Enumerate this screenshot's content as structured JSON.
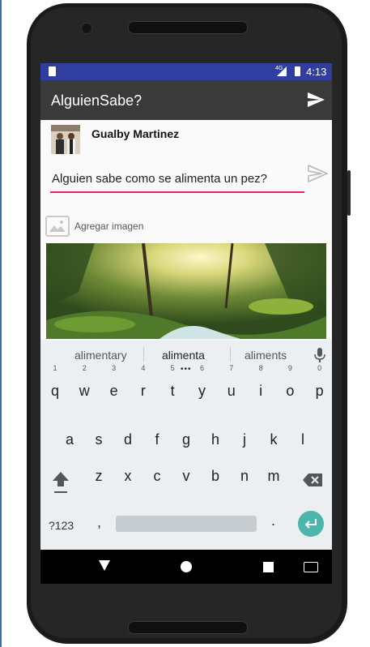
{
  "status_bar": {
    "network": "4G",
    "time": "4:13"
  },
  "app_bar": {
    "title": "AlguienSabe?"
  },
  "post": {
    "user_name": "Gualby Martinez",
    "question_value": "Alguien sabe como se alimenta un pez?",
    "add_image_label": "Agregar imagen"
  },
  "keyboard": {
    "suggestions": [
      "alimentary",
      "alimenta",
      "aliments"
    ],
    "row1": [
      {
        "k": "q",
        "n": "1"
      },
      {
        "k": "w",
        "n": "2"
      },
      {
        "k": "e",
        "n": "3"
      },
      {
        "k": "r",
        "n": "4"
      },
      {
        "k": "t",
        "n": "5"
      },
      {
        "k": "y",
        "n": "6"
      },
      {
        "k": "u",
        "n": "7"
      },
      {
        "k": "i",
        "n": "8"
      },
      {
        "k": "o",
        "n": "9"
      },
      {
        "k": "p",
        "n": "0"
      }
    ],
    "row2": [
      "a",
      "s",
      "d",
      "f",
      "g",
      "h",
      "j",
      "k",
      "l"
    ],
    "row3": [
      "z",
      "x",
      "c",
      "v",
      "b",
      "n",
      "m"
    ],
    "symbols_label": "?123",
    "comma": ",",
    "period": "."
  },
  "colors": {
    "status_bar": "#303f9f",
    "app_bar": "#3a3a3a",
    "input_underline": "#e91e63",
    "enter_key": "#4db6ac"
  }
}
